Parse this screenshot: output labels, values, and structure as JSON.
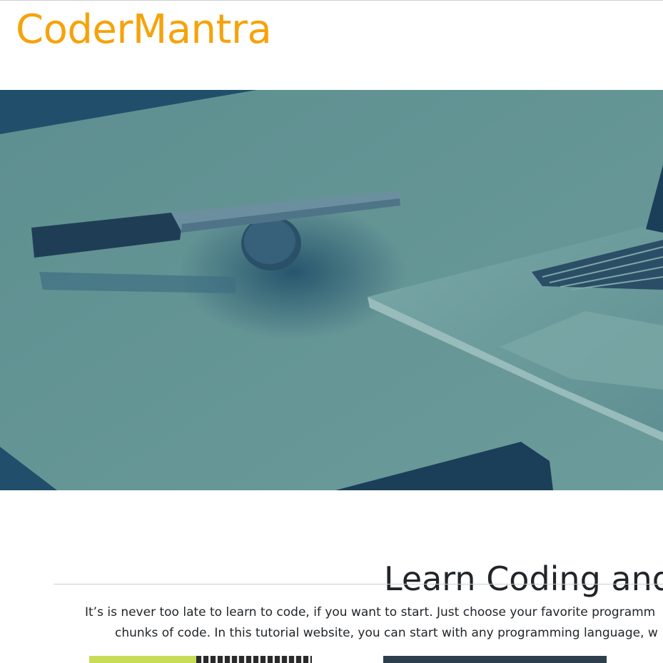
{
  "header": {
    "brand": "CoderMantra"
  },
  "hero": {
    "image_description": "desk-with-pen-and-laptop"
  },
  "intro": {
    "title": "Learn Coding and",
    "text_line1": "It’s is never too late to learn to code, if you want to start. Just choose your favorite programm",
    "text_line2": "chunks of code. In this tutorial website, you can start with any programming language, w"
  },
  "colors": {
    "brand": "#f5a30c",
    "text": "#212529",
    "hero_tint": "#5a8a8c",
    "thumb1": "#c8dc58",
    "thumb2": "#2d3f4c"
  }
}
